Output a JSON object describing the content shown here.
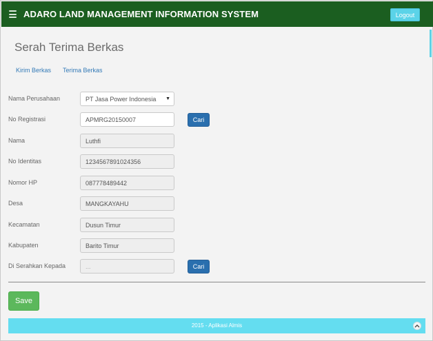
{
  "header": {
    "app_title": "ADARO LAND MANAGEMENT INFORMATION SYSTEM",
    "logout_label": "Logout",
    "bar_color": "#1b5e20",
    "menu_icon": "hamburger-menu-icon"
  },
  "page": {
    "title": "Serah Terima Berkas",
    "tabs": [
      {
        "label": "Kirim Berkas"
      },
      {
        "label": "Terima Berkas"
      }
    ]
  },
  "form": {
    "fields": [
      {
        "label": "Nama Perusahaan",
        "value": "PT Jasa Power Indonesia",
        "type": "select"
      },
      {
        "label": "No Registrasi",
        "value": "APMRG20150007",
        "type": "input"
      },
      {
        "label": "Nama",
        "value": "Luthfi",
        "type": "readonly"
      },
      {
        "label": "No Identitas",
        "value": "1234567891024356",
        "type": "readonly"
      },
      {
        "label": "Nomor HP",
        "value": "087778489442",
        "type": "readonly"
      },
      {
        "label": "Desa",
        "value": "MANGKAYAHU",
        "type": "readonly"
      },
      {
        "label": "Kecamatan",
        "value": "Dusun Timur",
        "type": "readonly"
      },
      {
        "label": "Kabupaten",
        "value": "Barito Timur",
        "type": "readonly"
      },
      {
        "label": "Di Serahkan Kepada",
        "placeholder": "...",
        "type": "readonly"
      }
    ],
    "cari_label": "Cari",
    "save_label": "Save"
  },
  "footer": {
    "text": "2015 - Aplikasi Almis",
    "color": "#64ddf0",
    "scroll_top_icon": "chevron-up-icon"
  }
}
